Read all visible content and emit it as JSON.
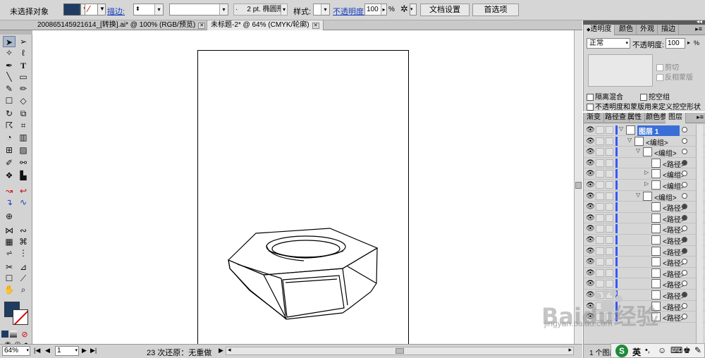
{
  "control_bar": {
    "selection_label": "未选择对象",
    "stroke_label": "描边:",
    "stroke_profile": "2 pt. 椭圆形",
    "style_label": "样式:",
    "opacity_label": "不透明度:",
    "opacity_value": "100",
    "opacity_unit": "%",
    "doc_setup_button": "文档设置",
    "preferences_button": "首选项"
  },
  "doc_tabs": [
    {
      "title": "200865145921614_[转换].ai* @ 100% (RGB/预览)",
      "close": "✕"
    },
    {
      "title": "未标题-2* @ 64% (CMYK/轮廓)",
      "close": "✕"
    }
  ],
  "status_bar": {
    "zoom": "64%",
    "artboard_num": "1",
    "status_text": "23 次还原：无重做"
  },
  "transparency_panel": {
    "tabs": [
      "透明度",
      "颜色",
      "外观",
      "描边"
    ],
    "blend_mode": "正常",
    "opacity_label": "不透明度:",
    "opacity_value": "100",
    "opacity_unit": "%",
    "clip_label": "剪切",
    "invert_mask_label": "反相蒙版",
    "isolate_blending_label": "隔离混合",
    "knockout_group_label": "挖空组",
    "opacity_mask_label": "不透明度和蒙版用来定义挖空形状"
  },
  "layers_panel": {
    "tabs": [
      "渐变",
      "路径查",
      "属性",
      "颜色参",
      "图层"
    ],
    "rows": [
      {
        "name": "图层 1",
        "indent": 0,
        "expanded": true,
        "highlight": true,
        "target_filled": false
      },
      {
        "name": "<编组>",
        "indent": 1,
        "expanded": true,
        "highlight": false,
        "target_filled": false
      },
      {
        "name": "<编组>",
        "indent": 2,
        "expanded": true,
        "highlight": false,
        "target_filled": false
      },
      {
        "name": "<路径>",
        "indent": 3,
        "expanded": false,
        "highlight": false,
        "target_filled": true
      },
      {
        "name": "<编组>",
        "indent": 3,
        "expanded": false,
        "highlight": false,
        "target_filled": false
      },
      {
        "name": "<编组>",
        "indent": 3,
        "expanded": false,
        "highlight": false,
        "target_filled": false
      },
      {
        "name": "<编组>",
        "indent": 2,
        "expanded": true,
        "highlight": false,
        "target_filled": false
      },
      {
        "name": "<路径>",
        "indent": 3,
        "expanded": false,
        "highlight": false,
        "target_filled": true
      },
      {
        "name": "<路径>",
        "indent": 3,
        "expanded": false,
        "highlight": false,
        "target_filled": true
      },
      {
        "name": "<路径>",
        "indent": 3,
        "expanded": false,
        "highlight": false,
        "target_filled": false
      },
      {
        "name": "<路径>",
        "indent": 3,
        "expanded": false,
        "highlight": false,
        "target_filled": true
      },
      {
        "name": "<路径>",
        "indent": 3,
        "expanded": false,
        "highlight": false,
        "target_filled": true
      },
      {
        "name": "<路径>",
        "indent": 3,
        "expanded": false,
        "highlight": false,
        "target_filled": false
      },
      {
        "name": "<路径>",
        "indent": 3,
        "expanded": false,
        "highlight": false,
        "target_filled": false
      },
      {
        "name": "<路径>",
        "indent": 3,
        "expanded": false,
        "highlight": false,
        "target_filled": false
      },
      {
        "name": "<路径>",
        "indent": 3,
        "expanded": false,
        "highlight": false,
        "target_filled": true
      },
      {
        "name": "<路径>",
        "indent": 3,
        "expanded": false,
        "highlight": false,
        "target_filled": false
      },
      {
        "name": "<路径>",
        "indent": 3,
        "expanded": false,
        "highlight": false,
        "target_filled": false
      }
    ],
    "footer_text": "1 个图层"
  },
  "watermark": {
    "text": "Baidu经验",
    "url": "jingyan.baidu.com"
  },
  "ime": {
    "lang": "英"
  },
  "colors": {
    "fill_swatch": "#1f3d63",
    "layer_highlight": "#3a6fd8",
    "color_bar": "#3557ff"
  }
}
